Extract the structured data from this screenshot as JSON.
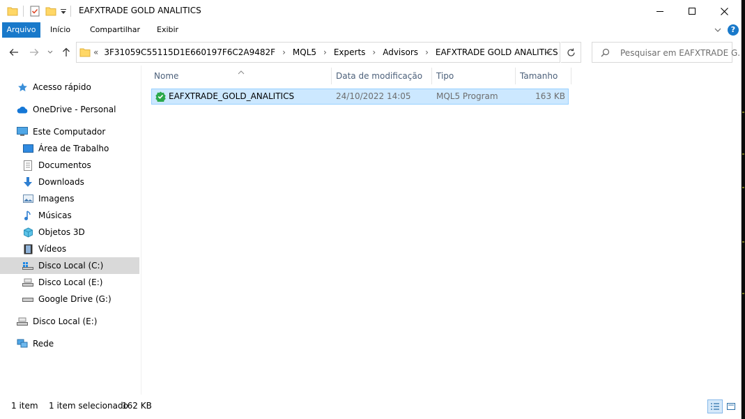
{
  "window": {
    "title": "EAFXTRADE GOLD ANALITICS",
    "controls": {
      "minimize": "—",
      "maximize": "☐",
      "close": "✕"
    }
  },
  "ribbon": {
    "tabs": [
      {
        "label": "Arquivo"
      },
      {
        "label": "Início"
      },
      {
        "label": "Compartilhar"
      },
      {
        "label": "Exibir"
      }
    ],
    "help_label": "?"
  },
  "address": {
    "overflow": "«",
    "crumbs": [
      "3F31059C55115D1E660197F6C2A9482F",
      "MQL5",
      "Experts",
      "Advisors",
      "EAFXTRADE GOLD ANALITICS"
    ]
  },
  "search": {
    "placeholder": "Pesquisar em EAFXTRADE G..."
  },
  "sidebar": {
    "items": [
      {
        "label": "Acesso rápido",
        "icon": "star-icon"
      },
      {
        "label": "OneDrive - Personal",
        "icon": "cloud-icon"
      },
      {
        "label": "Este Computador",
        "icon": "computer-icon"
      },
      {
        "label": "Área de Trabalho",
        "icon": "desktop-icon"
      },
      {
        "label": "Documentos",
        "icon": "document-icon"
      },
      {
        "label": "Downloads",
        "icon": "download-icon"
      },
      {
        "label": "Imagens",
        "icon": "image-icon"
      },
      {
        "label": "Músicas",
        "icon": "music-icon"
      },
      {
        "label": "Objetos 3D",
        "icon": "cube-icon"
      },
      {
        "label": "Vídeos",
        "icon": "video-icon"
      },
      {
        "label": "Disco Local (C:)",
        "icon": "windows-drive-icon"
      },
      {
        "label": "Disco Local (E:)",
        "icon": "drive-icon"
      },
      {
        "label": "Google Drive (G:)",
        "icon": "drive-icon"
      },
      {
        "label": "Disco Local (E:)",
        "icon": "drive-icon"
      },
      {
        "label": "Rede",
        "icon": "network-icon"
      }
    ]
  },
  "columns": [
    {
      "label": "Nome"
    },
    {
      "label": "Data de modificação"
    },
    {
      "label": "Tipo"
    },
    {
      "label": "Tamanho"
    }
  ],
  "files": [
    {
      "name": "EAFXTRADE_GOLD_ANALITICS",
      "modified": "24/10/2022 14:05",
      "type": "MQL5 Program",
      "size": "163 KB"
    }
  ],
  "status": {
    "count": "1 item",
    "selected": "1 item selecionado",
    "size": "162 KB"
  },
  "colors": {
    "accent": "#1979ca",
    "selection": "#cce8ff",
    "selection_border": "#99d1ff",
    "folder": "#ffd766"
  }
}
